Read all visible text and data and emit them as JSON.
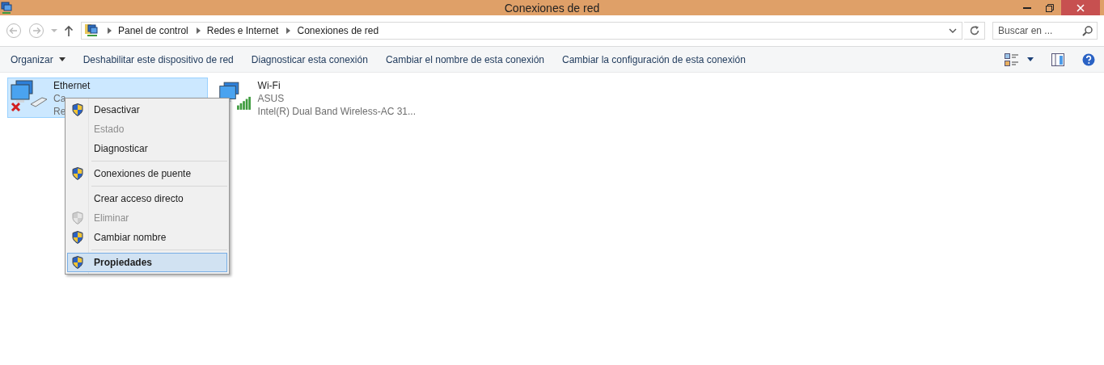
{
  "window": {
    "title": "Conexiones de red"
  },
  "address": {
    "crumbs": [
      "Panel de control",
      "Redes e Internet",
      "Conexiones de red"
    ]
  },
  "search": {
    "placeholder": "Buscar en ..."
  },
  "toolbar": {
    "items": [
      {
        "label": "Organizar",
        "dropdown": true
      },
      {
        "label": "Deshabilitar este dispositivo de red",
        "dropdown": false
      },
      {
        "label": "Diagnosticar esta conexión",
        "dropdown": false
      },
      {
        "label": "Cambiar el nombre de esta conexión",
        "dropdown": false
      },
      {
        "label": "Cambiar la configuración de esta conexión",
        "dropdown": false
      }
    ]
  },
  "connections": [
    {
      "name": "Ethernet",
      "status": "Ca",
      "device": "Re",
      "kind": "wired",
      "selected": true
    },
    {
      "name": "Wi-Fi",
      "status": "ASUS",
      "device": "Intel(R) Dual Band Wireless-AC 31...",
      "kind": "wireless",
      "selected": false
    }
  ],
  "context_menu": [
    {
      "kind": "item",
      "label": "Desactivar",
      "shield": true,
      "disabled": false,
      "default": false,
      "selected": false
    },
    {
      "kind": "item",
      "label": "Estado",
      "shield": false,
      "disabled": true,
      "default": false,
      "selected": false
    },
    {
      "kind": "item",
      "label": "Diagnosticar",
      "shield": false,
      "disabled": false,
      "default": false,
      "selected": false
    },
    {
      "kind": "separator"
    },
    {
      "kind": "item",
      "label": "Conexiones de puente",
      "shield": true,
      "disabled": false,
      "default": false,
      "selected": false
    },
    {
      "kind": "separator"
    },
    {
      "kind": "item",
      "label": "Crear acceso directo",
      "shield": false,
      "disabled": false,
      "default": false,
      "selected": false
    },
    {
      "kind": "item",
      "label": "Eliminar",
      "shield": true,
      "disabled": true,
      "default": false,
      "selected": false
    },
    {
      "kind": "item",
      "label": "Cambiar nombre",
      "shield": true,
      "disabled": false,
      "default": false,
      "selected": false
    },
    {
      "kind": "separator"
    },
    {
      "kind": "item",
      "label": "Propiedades",
      "shield": true,
      "disabled": false,
      "default": true,
      "selected": true
    }
  ]
}
